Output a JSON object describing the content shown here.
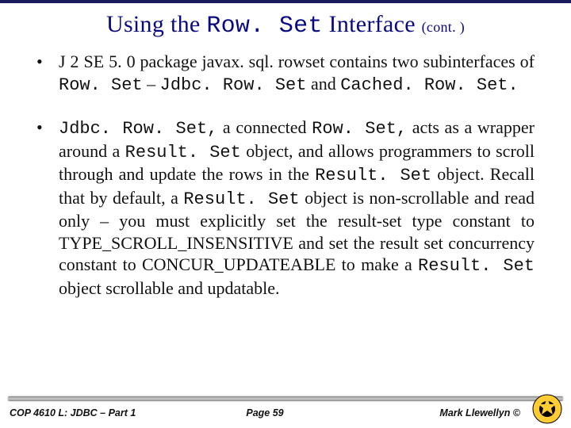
{
  "title": {
    "pre": "Using the ",
    "mono": "Row. Set",
    "post": " Interface ",
    "cont": "(cont. )"
  },
  "bullets": [
    {
      "segments": [
        {
          "t": "J 2 SE  5. 0  package  javax. sql. rowset  contains  two subinterfaces of ",
          "mono": false
        },
        {
          "t": "Row. Set",
          "mono": true
        },
        {
          "t": " – ",
          "mono": false
        },
        {
          "t": "Jdbc. Row. Set",
          "mono": true
        },
        {
          "t": " and ",
          "mono": false
        },
        {
          "t": "Cached. Row. Set.",
          "mono": true
        }
      ]
    },
    {
      "segments": [
        {
          "t": "Jdbc. Row. Set,",
          "mono": true
        },
        {
          "t": " a connected ",
          "mono": false
        },
        {
          "t": "Row. Set,",
          "mono": true
        },
        {
          "t": " acts as a wrapper around a ",
          "mono": false
        },
        {
          "t": "Result. Set",
          "mono": true
        },
        {
          "t": " object, and allows programmers to scroll through and update the rows in the ",
          "mono": false
        },
        {
          "t": "Result. Set",
          "mono": true
        },
        {
          "t": " object.  Recall that by default, a ",
          "mono": false
        },
        {
          "t": "Result. Set",
          "mono": true
        },
        {
          "t": " object is non-scrollable and read only – you must explicitly set the result-set type constant to TYPE_SCROLL_INSENSITIVE and set the result set concurrency constant to CONCUR_UPDATEABLE to make a ",
          "mono": false
        },
        {
          "t": "Result. Set",
          "mono": true
        },
        {
          "t": " object scrollable and updatable.",
          "mono": false
        }
      ]
    }
  ],
  "footer": {
    "left": "COP 4610 L: JDBC – Part 1",
    "center": "Page 59",
    "right": "Mark Llewellyn ©"
  }
}
